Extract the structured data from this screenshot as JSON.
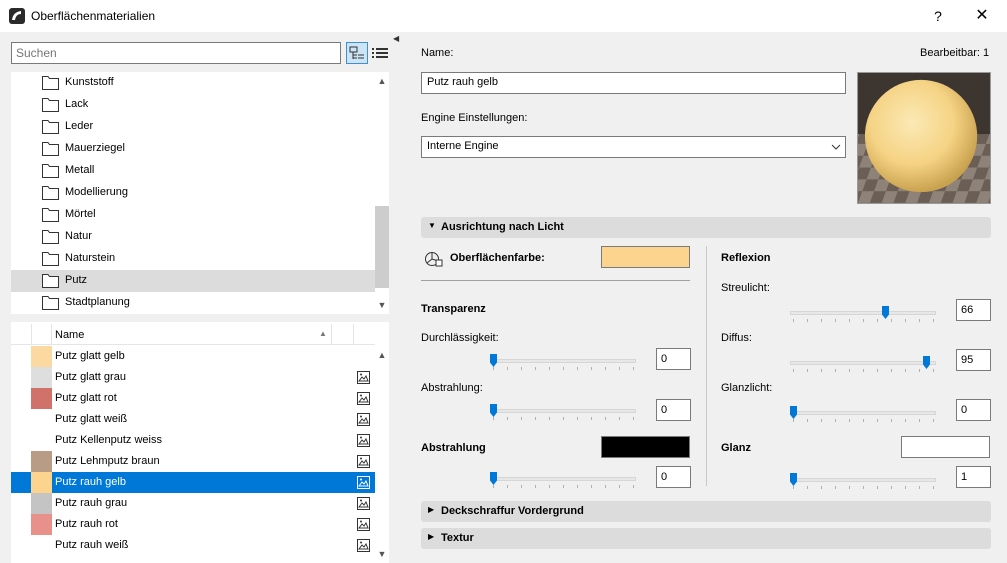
{
  "window": {
    "title": "Oberflächenmaterialien",
    "help": "?",
    "close": "✕"
  },
  "search": {
    "placeholder": "Suchen"
  },
  "folders": [
    {
      "label": "Kunststoff"
    },
    {
      "label": "Lack"
    },
    {
      "label": "Leder"
    },
    {
      "label": "Mauerziegel"
    },
    {
      "label": "Metall"
    },
    {
      "label": "Modellierung"
    },
    {
      "label": "Mörtel"
    },
    {
      "label": "Natur"
    },
    {
      "label": "Naturstein"
    },
    {
      "label": "Putz",
      "selected": true
    },
    {
      "label": "Stadtplanung"
    }
  ],
  "list": {
    "header_name": "Name",
    "items": [
      {
        "label": "Putz glatt gelb",
        "color": "#fbd9a0"
      },
      {
        "label": "Putz glatt grau",
        "color": "#dedede"
      },
      {
        "label": "Putz glatt rot",
        "color": "#d0726a"
      },
      {
        "label": "Putz glatt weiß",
        "color": "#ffffff"
      },
      {
        "label": "Putz Kellenputz weiss",
        "color": "#ffffff"
      },
      {
        "label": "Putz Lehmputz braun",
        "color": "#b99c86"
      },
      {
        "label": "Putz rauh gelb",
        "color": "#fdd48e",
        "selected": true
      },
      {
        "label": "Putz rauh grau",
        "color": "#c4c4c4"
      },
      {
        "label": "Putz rauh rot",
        "color": "#e8908a"
      },
      {
        "label": "Putz rauh weiß",
        "color": "#ffffff"
      }
    ]
  },
  "details": {
    "name_label": "Name:",
    "editable_label": "Bearbeitbar: 1",
    "name_value": "Putz rauh gelb",
    "engine_label": "Engine Einstellungen:",
    "engine_value": "Interne Engine"
  },
  "section_light": {
    "title": "Ausrichtung nach Licht",
    "surface_color_label": "Oberflächenfarbe:",
    "surface_color": "#fdd48e",
    "transparency_heading": "Transparenz",
    "permeability_label": "Durchlässigkeit:",
    "permeability_value": "0",
    "emission_label_small": "Abstrahlung:",
    "emission_small_value": "0",
    "emission_heading": "Abstrahlung",
    "emission_color": "#000000",
    "emission_value": "0",
    "reflection_heading": "Reflexion",
    "ambient_label": "Streulicht:",
    "ambient_value": "66",
    "diffuse_label": "Diffus:",
    "diffuse_value": "95",
    "specular_label": "Glanzlicht:",
    "specular_value": "0",
    "gloss_heading": "Glanz",
    "gloss_color": "#ffffff",
    "gloss_value": "1"
  },
  "section_hatch": {
    "title": "Deckschraffur Vordergrund"
  },
  "section_texture": {
    "title": "Textur"
  }
}
